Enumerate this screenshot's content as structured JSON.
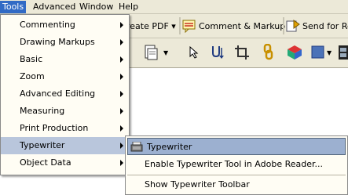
{
  "menubar": {
    "items": [
      {
        "label": "Tools"
      },
      {
        "label": "Advanced"
      },
      {
        "label": "Window"
      },
      {
        "label": "Help"
      }
    ]
  },
  "toolbar": {
    "create_pdf_label": "reate PDF",
    "comment_markup_label": "Comment & Markup",
    "send_review_label": "Send for Re"
  },
  "tools_menu": {
    "items": [
      {
        "label": "Commenting"
      },
      {
        "label": "Drawing Markups"
      },
      {
        "label": "Basic"
      },
      {
        "label": "Zoom"
      },
      {
        "label": "Advanced Editing"
      },
      {
        "label": "Measuring"
      },
      {
        "label": "Print Production"
      },
      {
        "label": "Typewriter"
      },
      {
        "label": "Object Data"
      }
    ]
  },
  "typewriter_submenu": {
    "items": [
      {
        "label": "Typewriter"
      },
      {
        "label": "Enable Typewriter Tool in Adobe Reader..."
      },
      {
        "label": "Show Typewriter Toolbar"
      }
    ]
  },
  "colors": {
    "menu_highlight": "#316ac5",
    "submenu_hover": "#b9c6dc",
    "submenu_selected": "#9cb0d0"
  }
}
